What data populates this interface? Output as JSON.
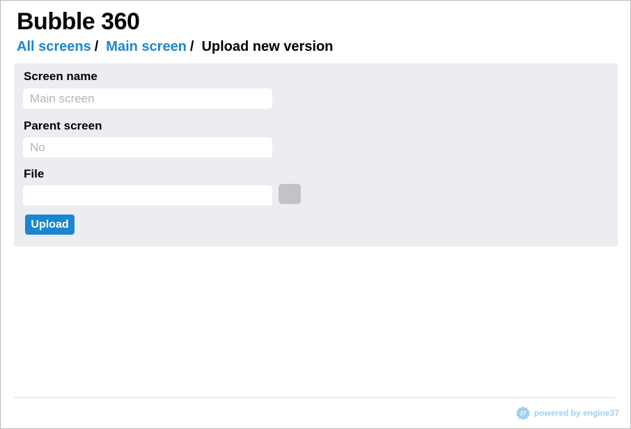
{
  "app": {
    "title": "Bubble 360"
  },
  "breadcrumb": {
    "items": [
      {
        "label": "All screens"
      },
      {
        "label": "Main screen"
      }
    ],
    "separator": "/",
    "current": "Upload new version"
  },
  "form": {
    "screen_name": {
      "label": "Screen name",
      "placeholder": "Main screen",
      "value": ""
    },
    "parent_screen": {
      "label": "Parent screen",
      "placeholder": "No",
      "value": ""
    },
    "file": {
      "label": "File",
      "value": ""
    },
    "upload_label": "Upload"
  },
  "footer": {
    "powered_text": "powered by engine37",
    "badge_text": "37"
  },
  "colors": {
    "accent": "#1a86d0",
    "panel_bg": "#ecedf1",
    "browse_button": "#c2c2cb",
    "footer_link": "#9ecff0"
  }
}
